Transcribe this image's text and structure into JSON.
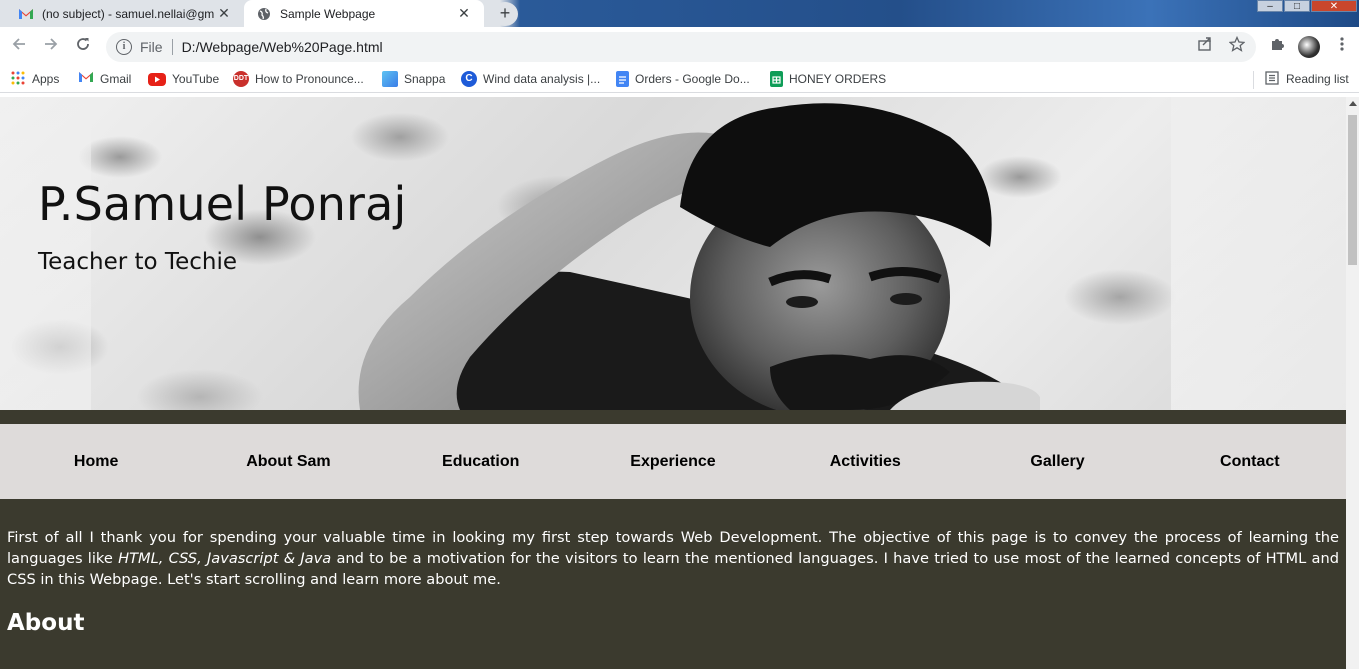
{
  "browser": {
    "tabs": [
      {
        "title": "(no subject) - samuel.nellai@gma",
        "icon": "gmail-icon",
        "active": false
      },
      {
        "title": "Sample Webpage",
        "icon": "globe-icon",
        "active": true
      }
    ],
    "new_tab_glyph": "+",
    "window_controls": {
      "minimize": "–",
      "maximize": "□",
      "close": "✕"
    },
    "omnibox": {
      "security_label": "File",
      "url": "D:/Webpage/Web%20Page.html"
    },
    "bookmarks": [
      {
        "label": "Apps",
        "icon": "apps-grid-icon"
      },
      {
        "label": "Gmail",
        "icon": "gmail-icon"
      },
      {
        "label": "YouTube",
        "icon": "youtube-icon"
      },
      {
        "label": "How to Pronounce...",
        "icon": "pronounce-icon"
      },
      {
        "label": "Snappa",
        "icon": "snappa-icon"
      },
      {
        "label": "Wind data analysis |...",
        "icon": "c-icon"
      },
      {
        "label": "Orders - Google Do...",
        "icon": "google-docs-icon"
      },
      {
        "label": "HONEY ORDERS",
        "icon": "google-sheets-icon"
      }
    ],
    "reading_list": "Reading list"
  },
  "page": {
    "hero": {
      "name": "P.Samuel Ponraj",
      "tagline": "Teacher to Techie"
    },
    "nav": [
      "Home",
      "About Sam",
      "Education",
      "Experience",
      "Activities",
      "Gallery",
      "Contact"
    ],
    "intro": {
      "part1": "First of all I thank you for spending your valuable time in looking my first step towards Web Development. The objective of this page is to convey the process of learning the languages like ",
      "languages": "HTML, CSS, Javascript & Java",
      "part2": " and to be a motivation for the visitors to learn the mentioned languages. I have tried to use most of the learned concepts of HTML and CSS in this Webpage. Let's start scrolling and learn more about me."
    },
    "about_heading": "About"
  },
  "colors": {
    "content_bg": "#3b3a2e",
    "nav_bg": "#dedbda",
    "tab_strip": "#dfe3e8"
  }
}
